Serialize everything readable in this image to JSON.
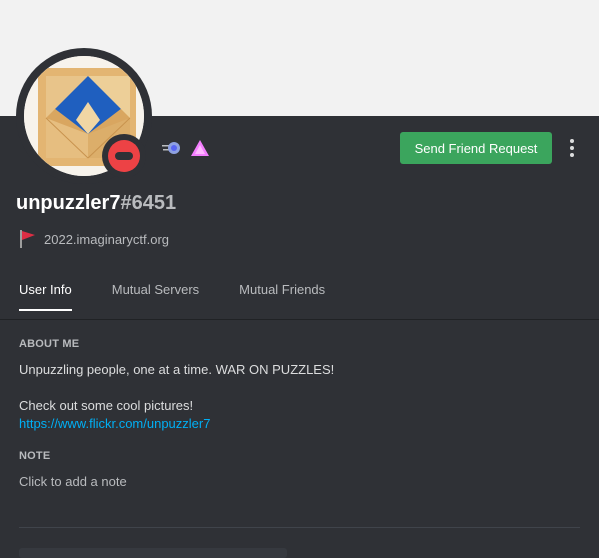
{
  "profile": {
    "username": "unpuzzler7",
    "discriminator": "#6451",
    "status": "do-not-disturb",
    "custom_status_emoji": "red-flag-icon",
    "custom_status_text": "2022.imaginaryctf.org",
    "badges": [
      "hypesquad-icon",
      "triangle-badge-icon"
    ],
    "friend_button_label": "Send Friend Request"
  },
  "tabs": [
    {
      "label": "User Info",
      "active": true
    },
    {
      "label": "Mutual Servers",
      "active": false
    },
    {
      "label": "Mutual Friends",
      "active": false
    }
  ],
  "about": {
    "heading": "About Me",
    "line1": "Unpuzzling people, one at a time. WAR ON PUZZLES!",
    "line2": "Check out some cool pictures!",
    "link": "https://www.flickr.com/unpuzzler7"
  },
  "note": {
    "heading": "Note",
    "placeholder": "Click to add a note"
  },
  "colors": {
    "background": "#2f3136",
    "banner": "#f2f2f2",
    "button": "#3ba55d",
    "status_dnd": "#ed4245",
    "link": "#00aff4"
  }
}
